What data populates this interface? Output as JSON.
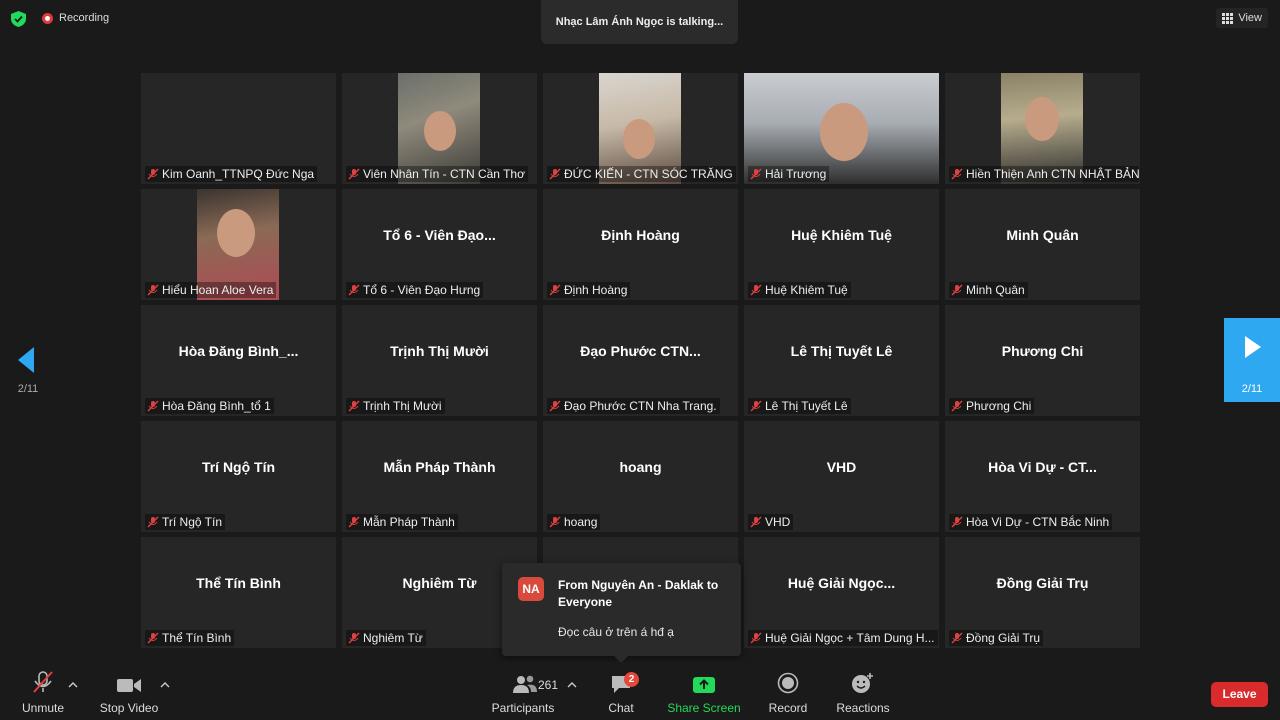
{
  "topbar": {
    "recording_label": "Recording",
    "talking_banner": "Nhạc Lâm Ánh Ngọc is talking...",
    "view_label": "View"
  },
  "navigation": {
    "page_indicator_left": "2/11",
    "page_indicator_right": "2/11"
  },
  "participants": [
    {
      "label": "Kim Oanh_TTNPQ Đức Nga",
      "display": "",
      "video": "none"
    },
    {
      "label": "Viên Nhân Tín - CTN Cần Thơ",
      "display": "",
      "video": "v1"
    },
    {
      "label": "ĐỨC KIẾN - CTN SÓC TRĂNG",
      "display": "",
      "video": "v2"
    },
    {
      "label": "Hải Trương",
      "display": "",
      "video": "v3"
    },
    {
      "label": "Hiền Thiện Anh CTN NHẬT BẢN",
      "display": "",
      "video": "v4"
    },
    {
      "label": "Hiểu Hoan Aloe Vera",
      "display": "",
      "video": "v5"
    },
    {
      "label": "Tổ 6 - Viên Đạo Hưng",
      "display": "Tổ 6 - Viên Đạo...",
      "video": "none"
    },
    {
      "label": "Định Hoàng",
      "display": "Định Hoàng",
      "video": "none"
    },
    {
      "label": "Huệ Khiêm Tuệ",
      "display": "Huệ Khiêm Tuệ",
      "video": "none"
    },
    {
      "label": "Minh Quân",
      "display": "Minh Quân",
      "video": "none"
    },
    {
      "label": "Hòa Đăng Bình_tổ 1",
      "display": "Hòa Đăng Bình_...",
      "video": "none"
    },
    {
      "label": "Trịnh Thị Mười",
      "display": "Trịnh Thị Mười",
      "video": "none"
    },
    {
      "label": "Đạo Phước CTN Nha Trang.",
      "display": "Đạo Phước CTN...",
      "video": "none"
    },
    {
      "label": "Lê Thị Tuyết Lê",
      "display": "Lê Thị Tuyết Lê",
      "video": "none"
    },
    {
      "label": "Phương Chi",
      "display": "Phương Chi",
      "video": "none"
    },
    {
      "label": "Trí Ngộ Tín",
      "display": "Trí Ngộ Tín",
      "video": "none"
    },
    {
      "label": "Mẫn Pháp Thành",
      "display": "Mẫn Pháp Thành",
      "video": "none"
    },
    {
      "label": "hoang",
      "display": "hoang",
      "video": "none"
    },
    {
      "label": "VHD",
      "display": "VHD",
      "video": "none"
    },
    {
      "label": "Hòa Vi Dự - CTN Bắc Ninh",
      "display": "Hòa Vi Dự - CT...",
      "video": "none"
    },
    {
      "label": "Thể Tín Bình",
      "display": "Thể Tín Bình",
      "video": "none"
    },
    {
      "label": "Nghiêm Từ",
      "display": "Nghiêm Từ",
      "video": "none"
    },
    {
      "label": "",
      "display": "",
      "video": "none"
    },
    {
      "label": "Huệ Giải Ngọc + Tâm Dung H...",
      "display": "Huệ Giải Ngọc...",
      "video": "none"
    },
    {
      "label": "Đồng Giải Trụ",
      "display": "Đồng Giải Trụ",
      "video": "none"
    }
  ],
  "chat_popup": {
    "avatar_initials": "NA",
    "from": "From Nguyên An - Daklak to Everyone",
    "message": "Đọc câu ở trên á hđ ạ"
  },
  "toolbar": {
    "unmute_label": "Unmute",
    "stop_video_label": "Stop Video",
    "participants_count": "261",
    "participants_label": "Participants",
    "chat_label": "Chat",
    "chat_badge": "2",
    "share_screen_label": "Share Screen",
    "record_label": "Record",
    "reactions_label": "Reactions",
    "leave_label": "Leave"
  },
  "colors": {
    "accent_green": "#23d959",
    "nav_blue": "#2ea8f0",
    "leave_red": "#d92b2b",
    "muted_red": "#e04040"
  }
}
